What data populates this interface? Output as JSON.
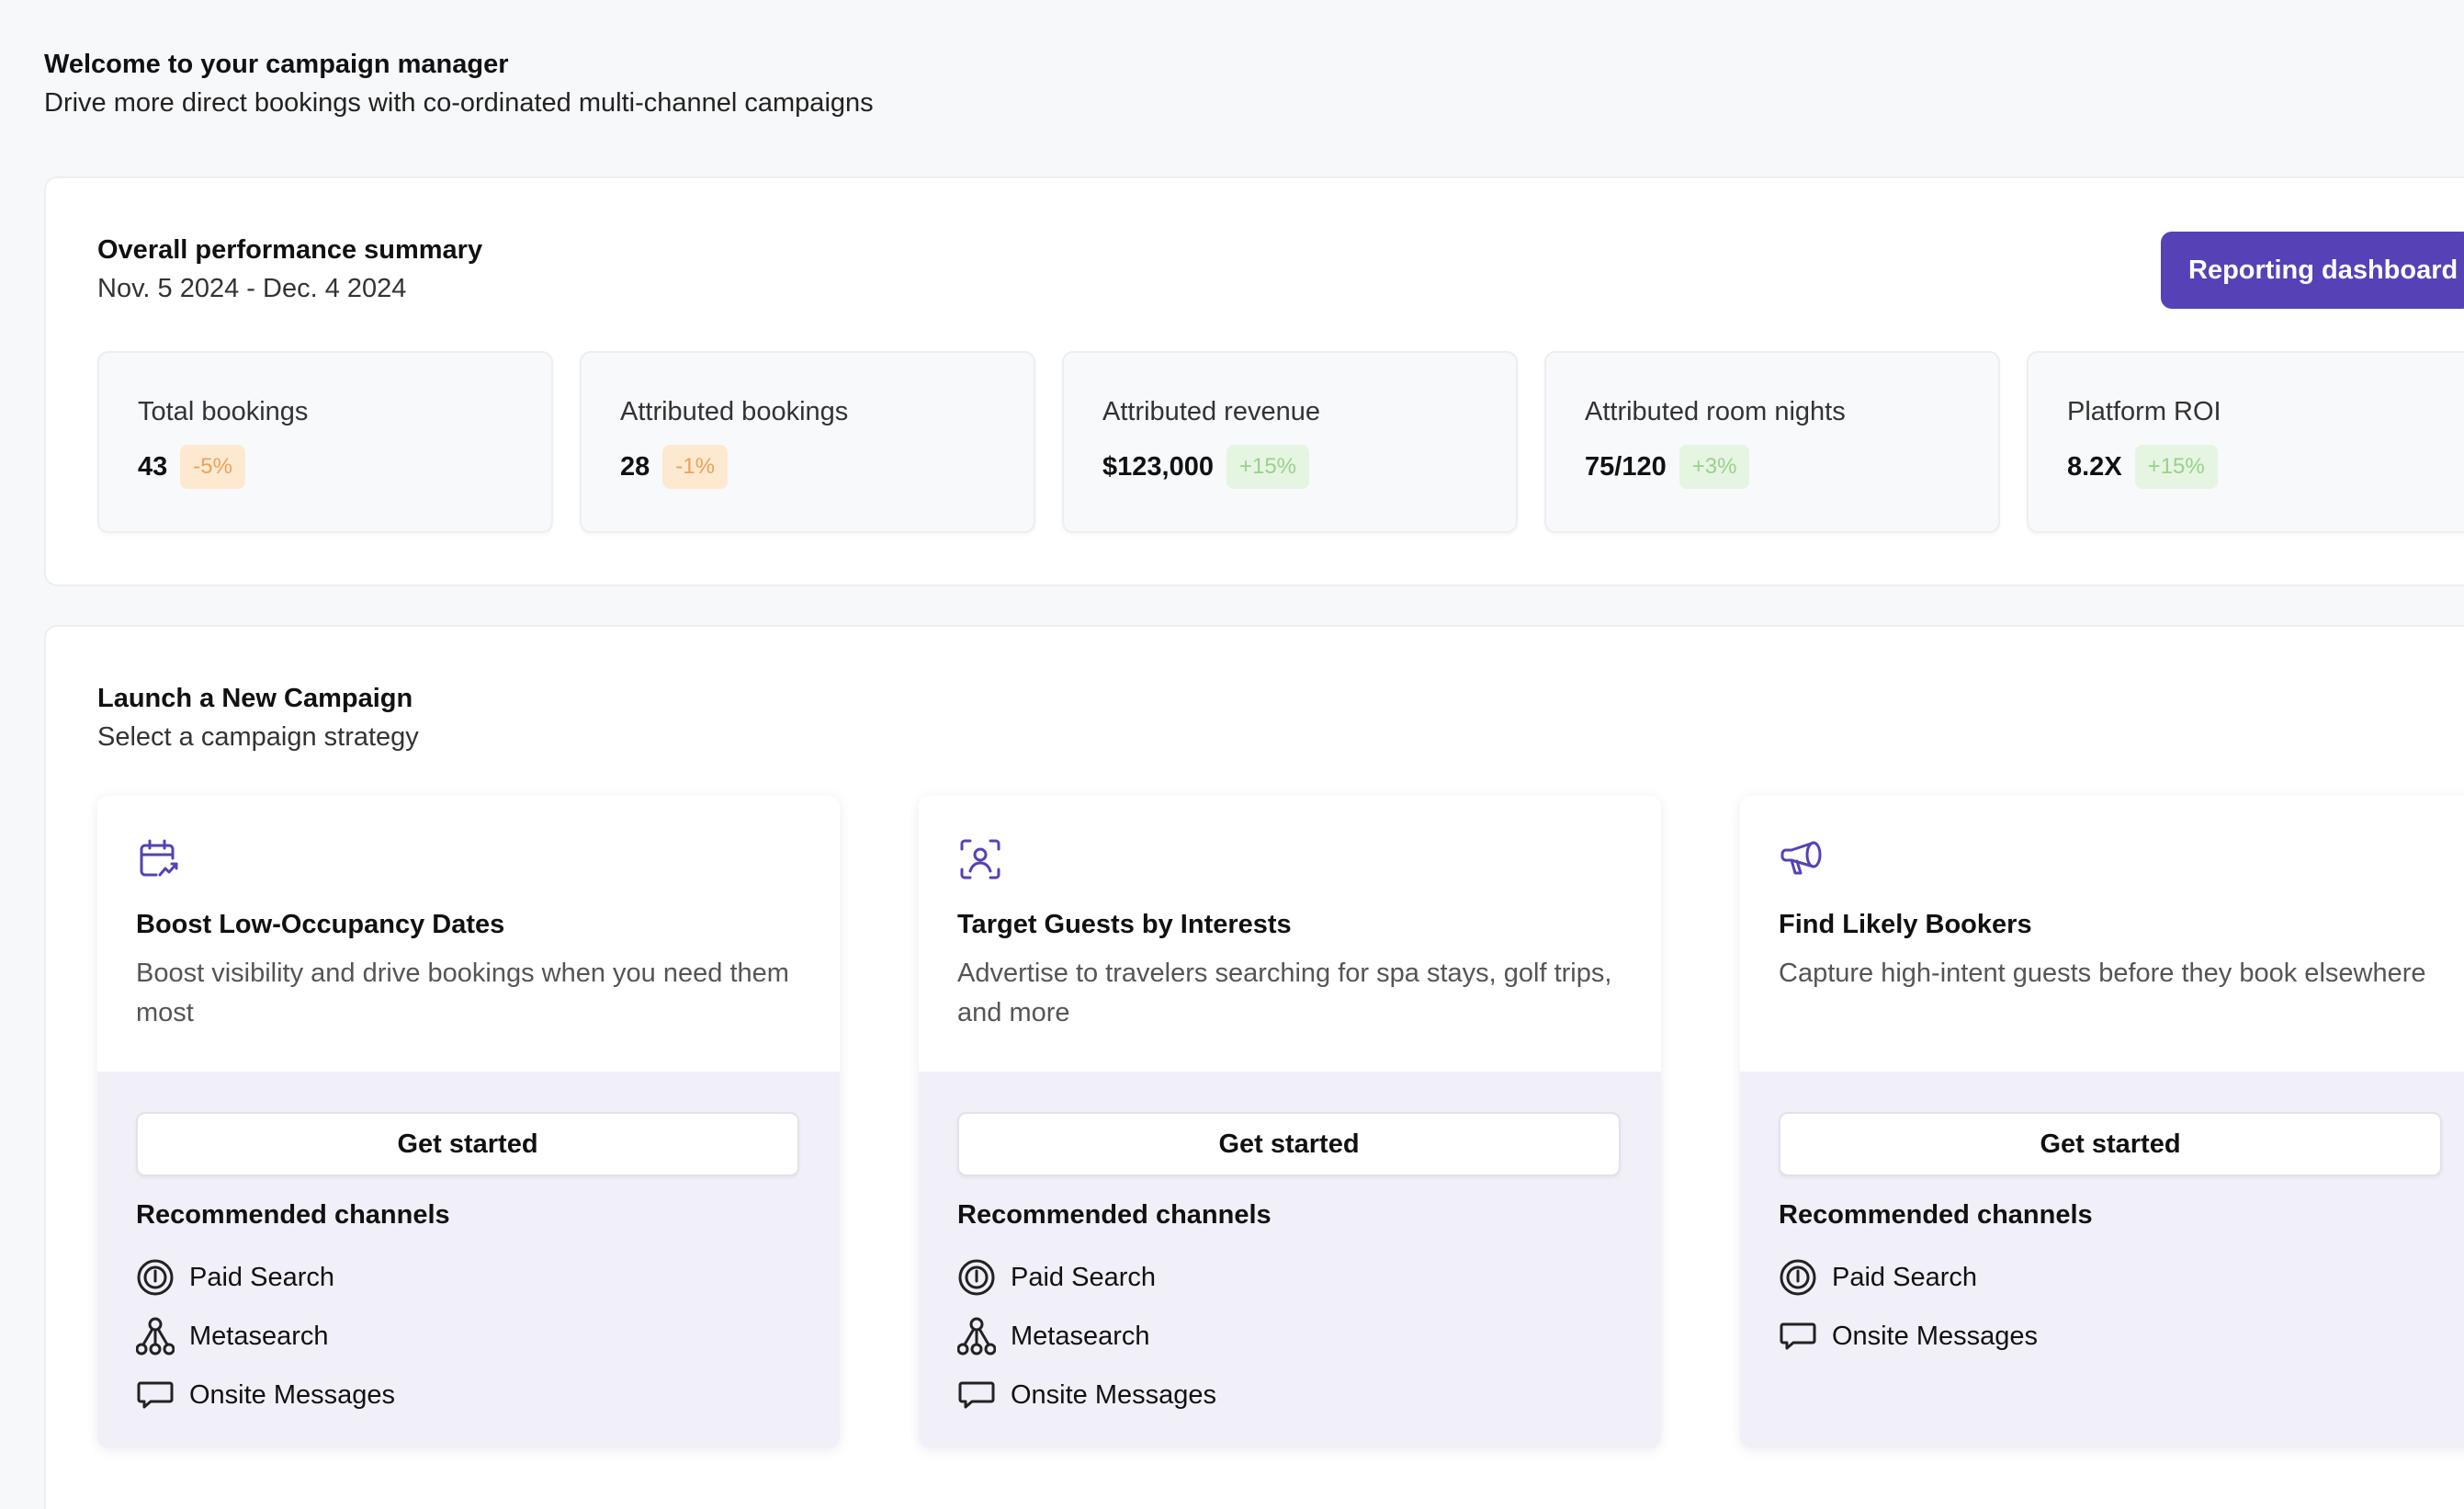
{
  "header": {
    "title": "Welcome to your campaign manager",
    "subtitle": "Drive more direct bookings with co-ordinated multi-channel campaigns"
  },
  "performance": {
    "title": "Overall performance summary",
    "date_range": "Nov. 5 2024 - Dec. 4 2024",
    "report_button": "Reporting dashboard",
    "metrics": [
      {
        "label": "Total bookings",
        "value": "43",
        "change": "-5%",
        "trend": "negative"
      },
      {
        "label": "Attributed bookings",
        "value": "28",
        "change": "-1%",
        "trend": "negative"
      },
      {
        "label": "Attributed revenue",
        "value": "$123,000",
        "change": "+15%",
        "trend": "positive"
      },
      {
        "label": "Attributed room nights",
        "value": "75/120",
        "change": "+3%",
        "trend": "positive"
      },
      {
        "label": "Platform ROI",
        "value": "8.2X",
        "change": "+15%",
        "trend": "positive"
      }
    ]
  },
  "campaign": {
    "title": "Launch a New Campaign",
    "subtitle": "Select a campaign strategy",
    "cards": [
      {
        "icon": "calendar-trend-icon",
        "title": "Boost Low-Occupancy Dates",
        "description": "Boost visibility and drive bookings when you need them most",
        "button": "Get started",
        "channels_title": "Recommended channels",
        "channels": [
          "Paid Search",
          "Metasearch",
          "Onsite Messages"
        ]
      },
      {
        "icon": "user-focus-icon",
        "title": "Target Guests by Interests",
        "description": "Advertise to travelers searching for spa stays, golf trips, and more",
        "button": "Get started",
        "channels_title": "Recommended channels",
        "channels": [
          "Paid Search",
          "Metasearch",
          "Onsite Messages"
        ]
      },
      {
        "icon": "megaphone-icon",
        "title": "Find Likely Bookers",
        "description": "Capture high-intent guests before they book elsewhere",
        "button": "Get started",
        "channels_title": "Recommended channels",
        "channels": [
          "Paid Search",
          "Onsite Messages"
        ]
      }
    ]
  },
  "colors": {
    "accent": "#5641b6",
    "negative_badge_bg": "#fde9d0",
    "negative_badge_text": "#e9a35a",
    "positive_badge_bg": "#e5f5e2",
    "positive_badge_text": "#9bd08b",
    "card_footer_bg": "#f1f0f8"
  }
}
